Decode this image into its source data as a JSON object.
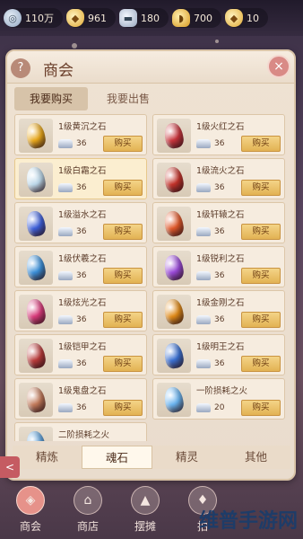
{
  "currencies": [
    {
      "icon": "jade-coin-icon",
      "value": "110万"
    },
    {
      "icon": "gold-ingot-icon",
      "value": "961"
    },
    {
      "icon": "silver-ingot-icon",
      "value": "180"
    },
    {
      "icon": "gold-boat-icon",
      "value": "700"
    },
    {
      "icon": "gold-ingot-icon",
      "value": "10"
    }
  ],
  "panel": {
    "help_label": "?",
    "title": "商会",
    "close_label": "×",
    "subtabs": [
      "我要购买",
      "我要出售"
    ]
  },
  "items": [
    {
      "name": "1级黄沉之石",
      "price": "36",
      "buy": "购买",
      "gem_color": "#e8a71a"
    },
    {
      "name": "1级火红之石",
      "price": "36",
      "buy": "购买",
      "gem_color": "#c8343c"
    },
    {
      "name": "1级白霜之石",
      "price": "36",
      "buy": "购买",
      "gem_color": "#bcd8ea"
    },
    {
      "name": "1级流火之石",
      "price": "36",
      "buy": "购买",
      "gem_color": "#c3322a"
    },
    {
      "name": "1级溢水之石",
      "price": "36",
      "buy": "购买",
      "gem_color": "#3c5ed8"
    },
    {
      "name": "1级轩辕之石",
      "price": "36",
      "buy": "购买",
      "gem_color": "#e0582a"
    },
    {
      "name": "1级伏羲之石",
      "price": "36",
      "buy": "购买",
      "gem_color": "#3a8fd8"
    },
    {
      "name": "1级锐利之石",
      "price": "36",
      "buy": "购买",
      "gem_color": "#9a4ad8"
    },
    {
      "name": "1级炫光之石",
      "price": "36",
      "buy": "购买",
      "gem_color": "#d83a7a"
    },
    {
      "name": "1级金刚之石",
      "price": "36",
      "buy": "购买",
      "gem_color": "#e08a18"
    },
    {
      "name": "1级铠甲之石",
      "price": "36",
      "buy": "购买",
      "gem_color": "#b83a3a"
    },
    {
      "name": "1级明王之石",
      "price": "36",
      "buy": "购买",
      "gem_color": "#3a6fd0"
    },
    {
      "name": "1级鬼盘之石",
      "price": "36",
      "buy": "购买",
      "gem_color": "#c27a5a"
    },
    {
      "name": "一阶损耗之火",
      "price": "20",
      "buy": "购买",
      "gem_color": "#6ab4f0"
    },
    {
      "name": "二阶损耗之火",
      "price": "",
      "buy": "",
      "gem_color": "#5a9ed8"
    }
  ],
  "category_tabs": [
    "精炼",
    "魂石",
    "精灵",
    "其他"
  ],
  "side_arrow": "<",
  "bottom_nav": [
    {
      "label": "商会",
      "icon": "merchant-guild-icon"
    },
    {
      "label": "商店",
      "icon": "shop-icon"
    },
    {
      "label": "摆摊",
      "icon": "stall-icon"
    },
    {
      "label": "拍",
      "icon": "auction-icon"
    }
  ],
  "watermark": "维普手游网"
}
